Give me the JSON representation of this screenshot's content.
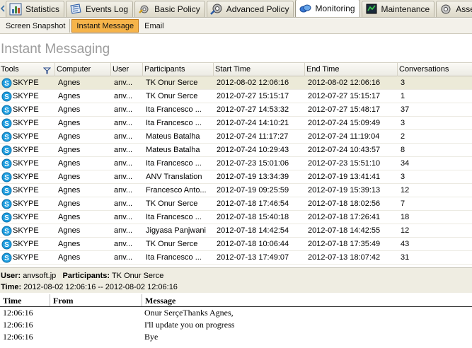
{
  "tabs": [
    {
      "label": "Statistics",
      "icon": "statistics-icon",
      "active": false
    },
    {
      "label": "Events Log",
      "icon": "events-log-icon",
      "active": false
    },
    {
      "label": "Basic Policy",
      "icon": "basic-policy-icon",
      "active": false
    },
    {
      "label": "Advanced Policy",
      "icon": "advanced-policy-icon",
      "active": false
    },
    {
      "label": "Monitoring",
      "icon": "monitoring-icon",
      "active": true
    },
    {
      "label": "Maintenance",
      "icon": "maintenance-icon",
      "active": false
    },
    {
      "label": "Asset",
      "icon": "asset-icon",
      "active": false
    }
  ],
  "subtabs": [
    {
      "label": "Screen Snapshot",
      "active": false
    },
    {
      "label": "Instant Message",
      "active": true
    },
    {
      "label": "Email",
      "active": false
    }
  ],
  "page_title": "Instant Messaging",
  "grid": {
    "columns": [
      "Tools",
      "Computer",
      "User",
      "Participants",
      "Start Time",
      "End Time",
      "Conversations"
    ],
    "rows": [
      {
        "tool": "SKYPE",
        "computer": "Agnes",
        "user": "anv...",
        "participants": "TK Onur Serce",
        "start": "2012-08-02 12:06:16",
        "end": "2012-08-02 12:06:16",
        "conv": "3",
        "selected": true
      },
      {
        "tool": "SKYPE",
        "computer": "Agnes",
        "user": "anv...",
        "participants": "TK Onur Serce",
        "start": "2012-07-27 15:15:17",
        "end": "2012-07-27 15:15:17",
        "conv": "1"
      },
      {
        "tool": "SKYPE",
        "computer": "Agnes",
        "user": "anv...",
        "participants": "Ita  Francesco ...",
        "start": "2012-07-27 14:53:32",
        "end": "2012-07-27 15:48:17",
        "conv": "37"
      },
      {
        "tool": "SKYPE",
        "computer": "Agnes",
        "user": "anv...",
        "participants": "Ita  Francesco ...",
        "start": "2012-07-24 14:10:21",
        "end": "2012-07-24 15:09:49",
        "conv": "3"
      },
      {
        "tool": "SKYPE",
        "computer": "Agnes",
        "user": "anv...",
        "participants": "Mateus Batalha",
        "start": "2012-07-24 11:17:27",
        "end": "2012-07-24 11:19:04",
        "conv": "2"
      },
      {
        "tool": "SKYPE",
        "computer": "Agnes",
        "user": "anv...",
        "participants": "Mateus Batalha",
        "start": "2012-07-24 10:29:43",
        "end": "2012-07-24 10:43:57",
        "conv": "8"
      },
      {
        "tool": "SKYPE",
        "computer": "Agnes",
        "user": "anv...",
        "participants": "Ita  Francesco ...",
        "start": "2012-07-23 15:01:06",
        "end": "2012-07-23 15:51:10",
        "conv": "34"
      },
      {
        "tool": "SKYPE",
        "computer": "Agnes",
        "user": "anv...",
        "participants": "ANV Translation",
        "start": "2012-07-19 13:34:39",
        "end": "2012-07-19 13:41:41",
        "conv": "3"
      },
      {
        "tool": "SKYPE",
        "computer": "Agnes",
        "user": "anv...",
        "participants": "Francesco Anto...",
        "start": "2012-07-19 09:25:59",
        "end": "2012-07-19 15:39:13",
        "conv": "12"
      },
      {
        "tool": "SKYPE",
        "computer": "Agnes",
        "user": "anv...",
        "participants": "TK Onur Serce",
        "start": "2012-07-18 17:46:54",
        "end": "2012-07-18 18:02:56",
        "conv": "7"
      },
      {
        "tool": "SKYPE",
        "computer": "Agnes",
        "user": "anv...",
        "participants": "Ita  Francesco ...",
        "start": "2012-07-18 15:40:18",
        "end": "2012-07-18 17:26:41",
        "conv": "18"
      },
      {
        "tool": "SKYPE",
        "computer": "Agnes",
        "user": "anv...",
        "participants": "Jigyasa Panjwani",
        "start": "2012-07-18 14:42:54",
        "end": "2012-07-18 14:42:55",
        "conv": "12"
      },
      {
        "tool": "SKYPE",
        "computer": "Agnes",
        "user": "anv...",
        "participants": "TK Onur Serce",
        "start": "2012-07-18 10:06:44",
        "end": "2012-07-18 17:35:49",
        "conv": "43"
      },
      {
        "tool": "SKYPE",
        "computer": "Agnes",
        "user": "anv...",
        "participants": "Ita  Francesco ...",
        "start": "2012-07-13 17:49:07",
        "end": "2012-07-13 18:07:42",
        "conv": "31"
      }
    ]
  },
  "detail": {
    "user_label": "User:",
    "user_value": "anvsoft.jp",
    "participants_label": "Participants:",
    "participants_value": "TK Onur Serce",
    "time_label": "Time:",
    "time_value": "2012-08-02 12:06:16 -- 2012-08-02 12:06:16"
  },
  "messages": {
    "headers": {
      "time": "Time",
      "from": "From",
      "message": "Message"
    },
    "rows": [
      {
        "time": "12:06:16",
        "from": "",
        "message": "Onur SerçeThanks Agnes,"
      },
      {
        "time": "12:06:16",
        "from": "",
        "message": "I'll update you on progress"
      },
      {
        "time": "12:06:16",
        "from": "",
        "message": "Bye"
      }
    ]
  },
  "colors": {
    "active_subtab": "#f6b44a",
    "selected_row": "#ecead8",
    "skype": "#1e9ee0"
  }
}
